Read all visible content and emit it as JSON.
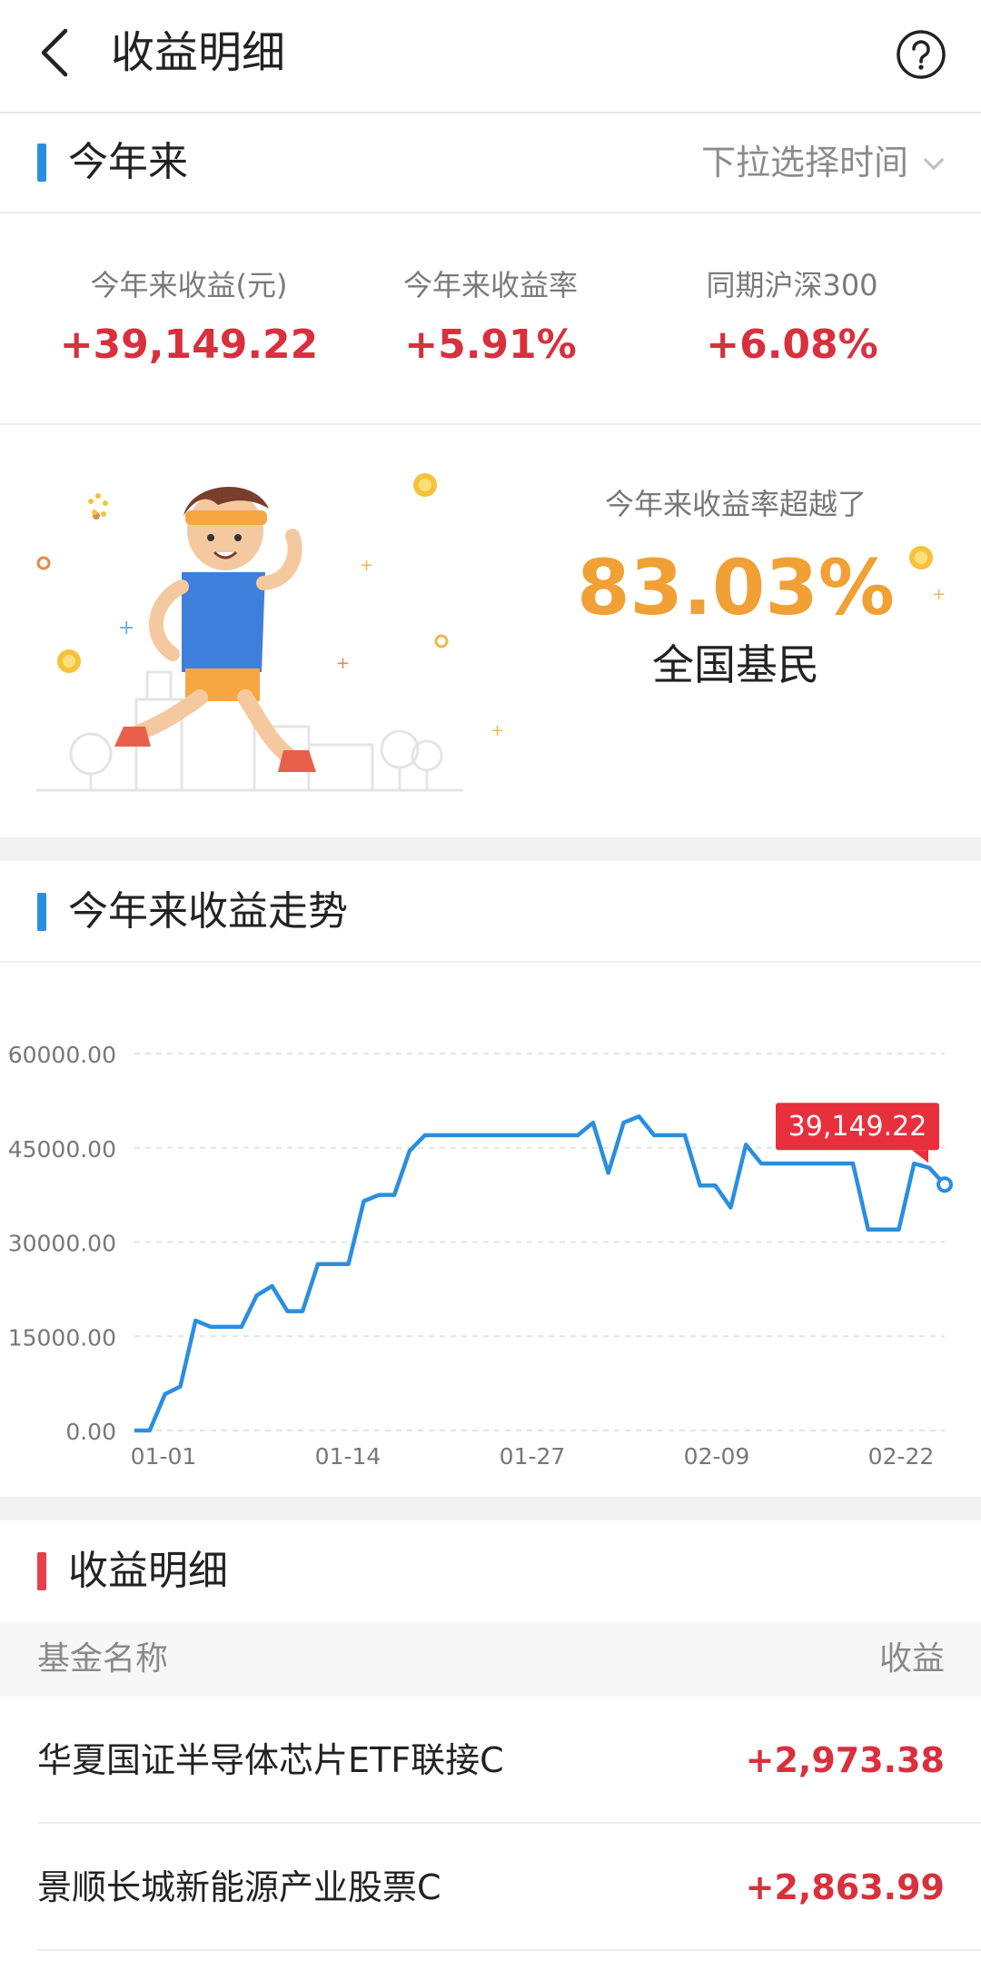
{
  "header": {
    "title": "收益明细",
    "back_icon": "chevron-left-icon",
    "help_icon": "question-circle-icon"
  },
  "ytd_section": {
    "title": "今年来",
    "picker_label": "下拉选择时间",
    "accent": "#2a8ee0"
  },
  "stats": [
    {
      "label": "今年来收益(元)",
      "value": "+39,149.22"
    },
    {
      "label": "今年来收益率",
      "value": "+5.91%"
    },
    {
      "label": "同期沪深300",
      "value": "+6.08%"
    }
  ],
  "beat": {
    "text": "今年来收益率超越了",
    "percent": "83.03%",
    "who": "全国基民"
  },
  "trend_section": {
    "title": "今年来收益走势"
  },
  "chart_data": {
    "type": "line",
    "y_ticks": [
      "60000.00",
      "45000.00",
      "30000.00",
      "15000.00",
      "0.00"
    ],
    "ylim": [
      0,
      60000
    ],
    "x_ticks": [
      "01-01",
      "01-14",
      "01-27",
      "02-09",
      "02-22"
    ],
    "series": [
      {
        "color": "#2a8ee0",
        "values": [
          0,
          0,
          5800,
          7000,
          17500,
          16500,
          16500,
          16500,
          21500,
          23000,
          19000,
          19000,
          26500,
          26500,
          26500,
          36500,
          37500,
          37500,
          44500,
          47000,
          47000,
          47000,
          47000,
          47000,
          47000,
          47000,
          47000,
          47000,
          47000,
          47000,
          49000,
          41000,
          49000,
          50000,
          47000,
          47000,
          47000,
          39000,
          39000,
          35500,
          45500,
          42500,
          42500,
          42500,
          42500,
          42500,
          42500,
          42500,
          32000,
          32000,
          32000,
          42500,
          41800,
          39149.22
        ]
      }
    ],
    "last_value_label": "39,149.22",
    "label_color": "#e8303d"
  },
  "detail_section": {
    "title": "收益明细",
    "accent": "#e8404b"
  },
  "table": {
    "col_name": "基金名称",
    "col_value": "收益",
    "rows": [
      {
        "name": "华夏国证半导体芯片ETF联接C",
        "value": "+2,973.38"
      },
      {
        "name": "景顺长城新能源产业股票C",
        "value": "+2,863.99"
      }
    ]
  }
}
